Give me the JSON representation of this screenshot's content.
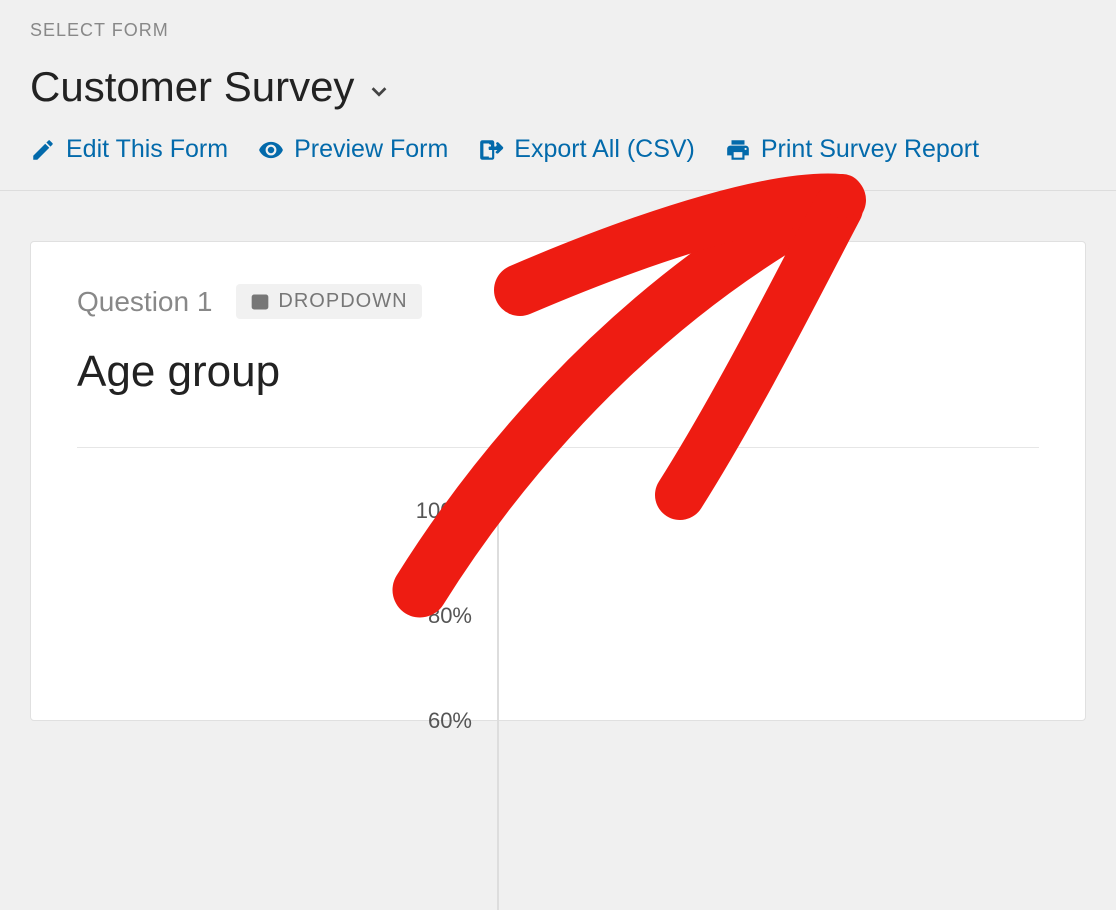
{
  "header": {
    "select_form_label": "SELECT FORM",
    "form_name": "Customer Survey"
  },
  "actions": {
    "edit": "Edit This Form",
    "preview": "Preview Form",
    "export": "Export All (CSV)",
    "print": "Print Survey Report"
  },
  "question": {
    "number_label": "Question 1",
    "field_type_label": "DROPDOWN",
    "title": "Age group"
  },
  "chart_data": {
    "type": "bar",
    "ylabel": "",
    "ylim": [
      0,
      100
    ],
    "ticks": {
      "y100": "100%",
      "y80": "80%",
      "y60": "60%"
    }
  }
}
